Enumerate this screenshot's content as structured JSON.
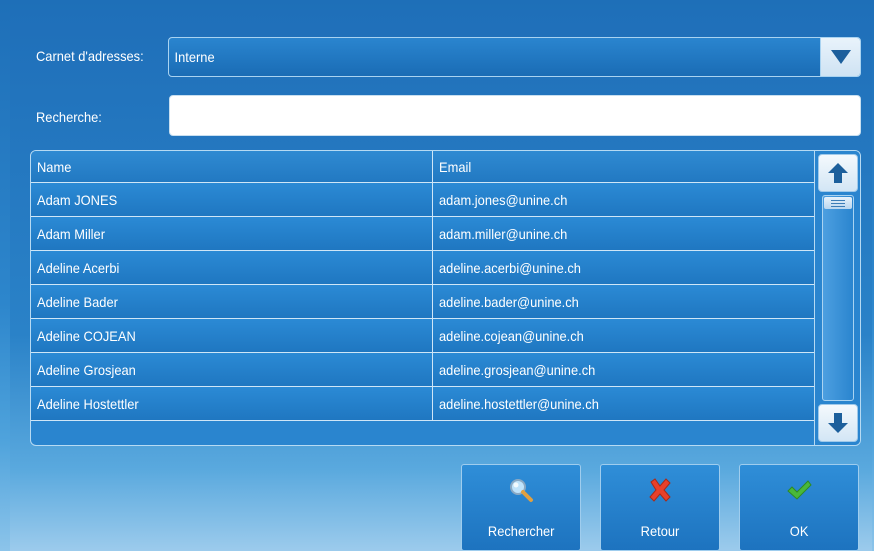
{
  "address_book": {
    "label": "Carnet d'adresses:",
    "value": "Interne"
  },
  "search": {
    "label": "Recherche:",
    "value": "",
    "placeholder": ""
  },
  "table": {
    "columns": [
      "Name",
      "Email"
    ],
    "rows": [
      {
        "name": "Adam JONES",
        "email": "adam.jones@unine.ch"
      },
      {
        "name": "Adam Miller",
        "email": "adam.miller@unine.ch"
      },
      {
        "name": "Adeline Acerbi",
        "email": "adeline.acerbi@unine.ch"
      },
      {
        "name": "Adeline Bader",
        "email": "adeline.bader@unine.ch"
      },
      {
        "name": "Adeline COJEAN",
        "email": "adeline.cojean@unine.ch"
      },
      {
        "name": "Adeline Grosjean",
        "email": "adeline.grosjean@unine.ch"
      },
      {
        "name": "Adeline Hostettler",
        "email": "adeline.hostettler@unine.ch"
      }
    ]
  },
  "buttons": {
    "search": {
      "label": "Rechercher",
      "icon": "magnifier-icon"
    },
    "back": {
      "label": "Retour",
      "icon": "red-x-icon"
    },
    "ok": {
      "label": "OK",
      "icon": "green-check-icon"
    }
  },
  "colors": {
    "accent": "#1f77c1",
    "back_icon": "#e8402a",
    "ok_icon": "#49b83a"
  }
}
